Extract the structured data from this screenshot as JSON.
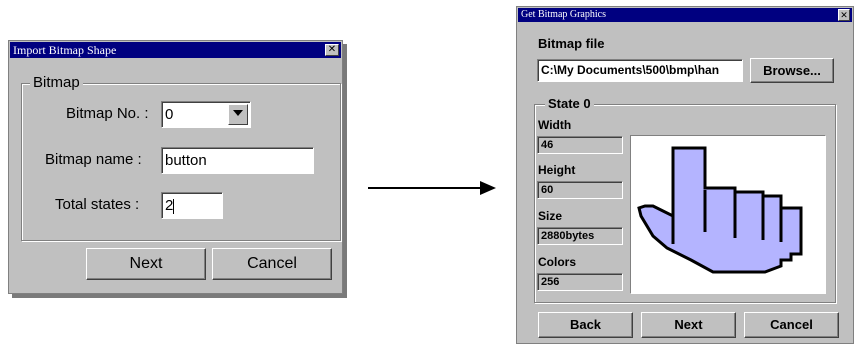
{
  "import_dialog": {
    "title": "Import Bitmap Shape",
    "group_label": "Bitmap",
    "bitmap_no_label": "Bitmap No. :",
    "bitmap_no_value": "0",
    "bitmap_name_label": "Bitmap name :",
    "bitmap_name_value": "button",
    "total_states_label": "Total states :",
    "total_states_value": "2",
    "next_label": "Next",
    "cancel_label": "Cancel"
  },
  "get_dialog": {
    "title": "Get Bitmap Graphics",
    "bitmap_file_label": "Bitmap file",
    "bitmap_file_value": "C:\\My Documents\\500\\bmp\\han",
    "browse_label": "Browse...",
    "state_group_label": "State 0",
    "width_label": "Width",
    "width_value": "46",
    "height_label": "Height",
    "height_value": "60",
    "size_label": "Size",
    "size_value": "2880bytes",
    "colors_label": "Colors",
    "colors_value": "256",
    "back_label": "Back",
    "next_label": "Next",
    "cancel_label": "Cancel"
  },
  "colors": {
    "dialog_bg": "#c0c0c0",
    "titlebar": "#000080",
    "hand_fill": "#b4b4ff"
  },
  "icons": {
    "close": "close-icon",
    "dropdown": "chevron-down-icon",
    "arrow": "right-arrow-icon",
    "preview": "pointing-hand-bitmap"
  }
}
